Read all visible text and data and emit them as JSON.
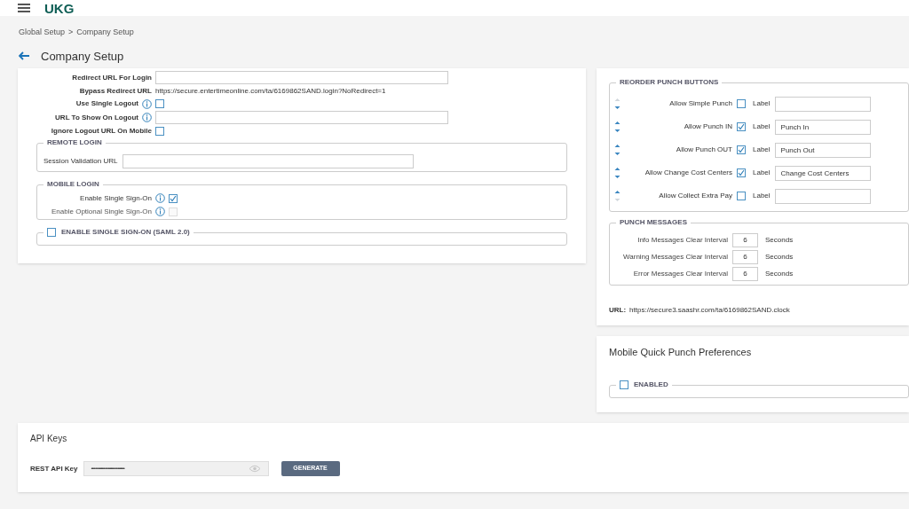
{
  "header": {
    "logo": "UKG"
  },
  "breadcrumb": {
    "items": [
      "Global Setup",
      "Company Setup"
    ],
    "separator": ">"
  },
  "page_title": "Company Setup",
  "login_settings": {
    "rows": [
      {
        "kind": "input",
        "label": "Redirect URL For Login",
        "info": false
      },
      {
        "kind": "text",
        "label": "Bypass Redirect URL",
        "info": false,
        "value": "https://secure.entertimeonline.com/ta/6169862SAND.login?NoRedirect=1"
      },
      {
        "kind": "checkbox",
        "label": "Use Single Logout",
        "info": true,
        "checked": false
      },
      {
        "kind": "input",
        "label": "URL To Show On Logout",
        "info": true
      },
      {
        "kind": "checkbox",
        "label": "Ignore Logout URL On Mobile",
        "info": false,
        "checked": false
      }
    ]
  },
  "remote_login": {
    "title": "REMOTE LOGIN",
    "fields": [
      {
        "label": "Session Validation URL"
      }
    ]
  },
  "mobile_login": {
    "title": "MOBILE LOGIN",
    "options": [
      {
        "label": "Enable Single Sign-On",
        "checked": true,
        "disabled": false
      },
      {
        "label": "Enable Optional Single Sign-On",
        "checked": false,
        "disabled": true
      }
    ]
  },
  "saml": {
    "label": "ENABLE SINGLE SIGN-ON (SAML 2.0)",
    "checked": false
  },
  "reorder_punch_buttons": {
    "title": "REORDER PUNCH BUTTONS",
    "rows": [
      {
        "label": "Allow Simple Punch",
        "checked": false,
        "field_label": "Label",
        "can_move_up": false,
        "can_move_down": true
      },
      {
        "label": "Allow Punch IN",
        "checked": true,
        "field_label": "Label",
        "value": "Punch In",
        "can_move_up": true,
        "can_move_down": true
      },
      {
        "label": "Allow Punch OUT",
        "checked": true,
        "field_label": "Label",
        "value": "Punch Out",
        "can_move_up": true,
        "can_move_down": true
      },
      {
        "label": "Allow Change Cost Centers",
        "checked": true,
        "field_label": "Label",
        "value": "Change Cost Centers",
        "can_move_up": true,
        "can_move_down": true
      },
      {
        "label": "Allow Collect Extra Pay",
        "checked": false,
        "field_label": "Label",
        "can_move_up": true,
        "can_move_down": false
      }
    ]
  },
  "punch_messages": {
    "title": "PUNCH MESSAGES",
    "rows": [
      {
        "label": "Info Messages Clear Interval",
        "value": "6",
        "unit": "Seconds"
      },
      {
        "label": "Warning Messages Clear Interval",
        "value": "6",
        "unit": "Seconds"
      },
      {
        "label": "Error Messages Clear Interval",
        "value": "6",
        "unit": "Seconds"
      }
    ]
  },
  "clock_url": {
    "label": "URL:",
    "value": "https://secure3.saashr.com/ta/6169862SAND.clock"
  },
  "mobile_quick_punch": {
    "title": "Mobile Quick Punch Preferences",
    "enabled": {
      "label": "ENABLED",
      "checked": false
    }
  },
  "api_keys": {
    "title": "API Keys",
    "label": "REST API Key",
    "value": "••••••••••••••••••••••••••••••••••",
    "button": "GENERATE"
  }
}
